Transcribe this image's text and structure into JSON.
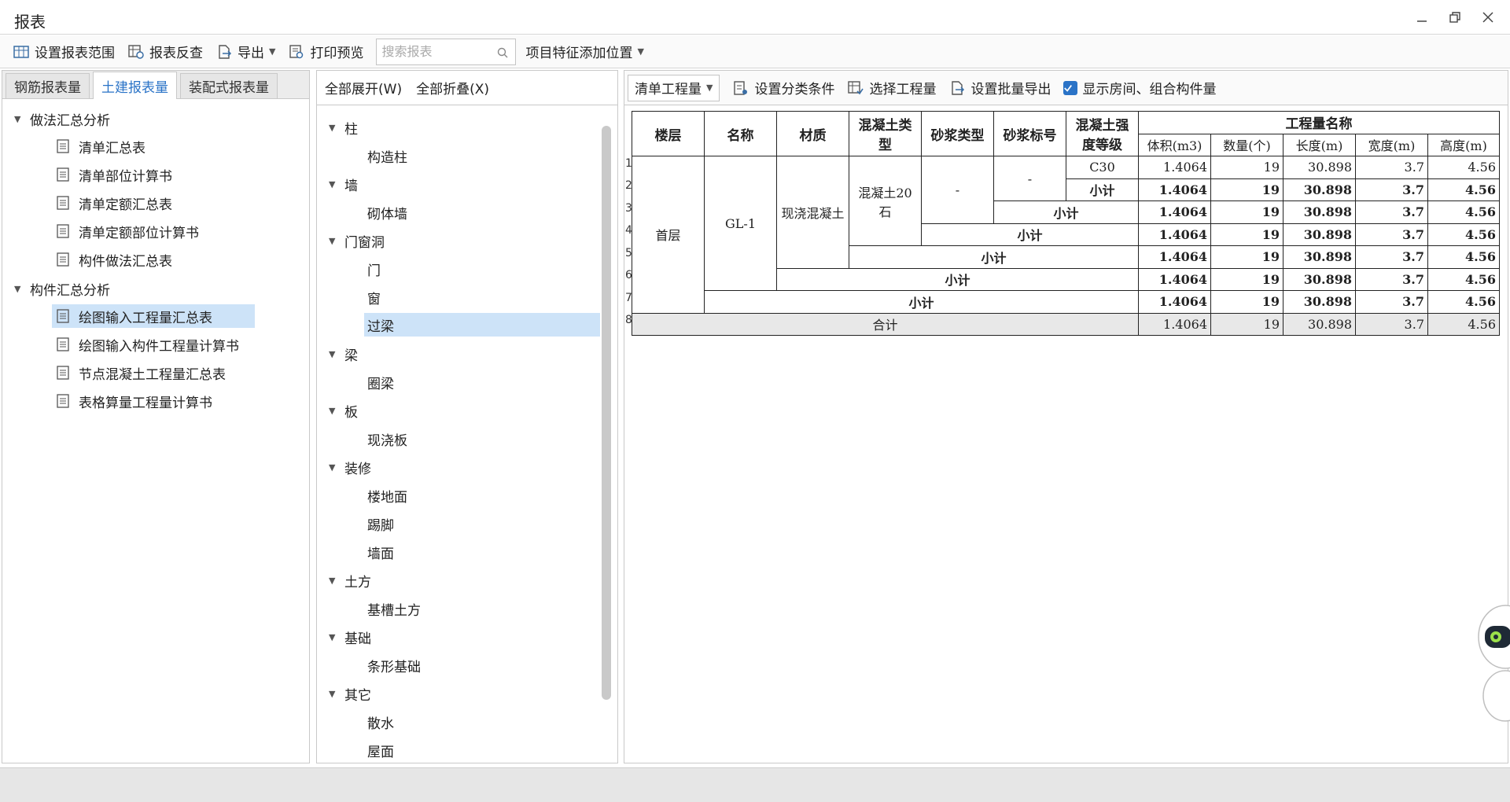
{
  "window": {
    "title": "报表"
  },
  "toolbar": {
    "set_range": "设置报表范围",
    "reverse_check": "报表反查",
    "export": "导出",
    "print_preview": "打印预览",
    "search_placeholder": "搜索报表",
    "feature_position": "项目特征添加位置"
  },
  "left": {
    "tabs": [
      "钢筋报表量",
      "土建报表量",
      "装配式报表量"
    ],
    "active_tab": 1,
    "groups": [
      {
        "label": "做法汇总分析",
        "items": [
          "清单汇总表",
          "清单部位计算书",
          "清单定额汇总表",
          "清单定额部位计算书",
          "构件做法汇总表"
        ]
      },
      {
        "label": "构件汇总分析",
        "items": [
          "绘图输入工程量汇总表",
          "绘图输入构件工程量计算书",
          "节点混凝土工程量汇总表",
          "表格算量工程量计算书"
        ]
      }
    ],
    "selected": "绘图输入工程量汇总表"
  },
  "middle": {
    "expand_all": "全部展开(W)",
    "collapse_all": "全部折叠(X)",
    "tree": [
      {
        "label": "柱",
        "children": [
          "构造柱"
        ]
      },
      {
        "label": "墙",
        "children": [
          "砌体墙"
        ]
      },
      {
        "label": "门窗洞",
        "children": [
          "门",
          "窗",
          "过梁"
        ]
      },
      {
        "label": "梁",
        "children": [
          "圈梁"
        ]
      },
      {
        "label": "板",
        "children": [
          "现浇板"
        ]
      },
      {
        "label": "装修",
        "children": [
          "楼地面",
          "踢脚",
          "墙面"
        ]
      },
      {
        "label": "土方",
        "children": [
          "基槽土方"
        ]
      },
      {
        "label": "基础",
        "children": [
          "条形基础"
        ]
      },
      {
        "label": "其它",
        "children": [
          "散水",
          "屋面"
        ]
      }
    ],
    "selected": "过梁"
  },
  "right": {
    "mode_select": "清单工程量",
    "set_category": "设置分类条件",
    "select_quantity": "选择工程量",
    "batch_export": "设置批量导出",
    "show_rooms": "显示房间、组合构件量",
    "show_rooms_checked": true
  },
  "table": {
    "headers": {
      "floor": "楼层",
      "name": "名称",
      "material": "材质",
      "concrete_type": "混凝土类型",
      "mortar_type": "砂浆类型",
      "mortar_grade": "砂浆标号",
      "concrete_grade": "混凝土强度等级",
      "quantity_group": "工程量名称",
      "volume": "体积(m3)",
      "count": "数量(个)",
      "length": "长度(m)",
      "width": "宽度(m)",
      "height": "高度(m)"
    },
    "row_numbers": [
      "1",
      "2",
      "3",
      "4",
      "5",
      "6",
      "7",
      "8"
    ],
    "floor": "首层",
    "name": "GL-1",
    "material": "现浇混凝土",
    "concrete_type": "混凝土20石",
    "mortar_type": "-",
    "mortar_grade": "-",
    "concrete_grade": "C30",
    "subtotal": "小计",
    "total": "合计",
    "values": {
      "volume": "1.4064",
      "count": "19",
      "length": "30.898",
      "width": "3.7",
      "height": "4.56"
    }
  }
}
